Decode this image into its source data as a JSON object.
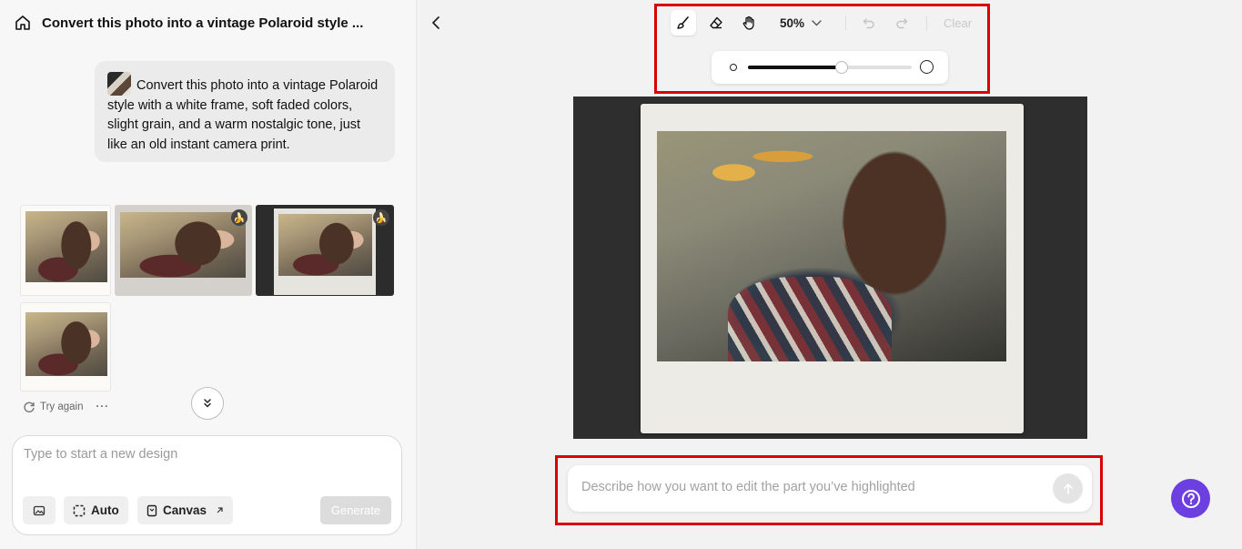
{
  "sidebar": {
    "title": "Convert this photo into a vintage Polaroid style ...",
    "prompt_bubble": "Convert this photo into a vintage Polaroid style with a white frame, soft faded colors, slight grain, and a warm nostalgic tone, just like an old instant camera print.",
    "actions": {
      "try_again": "Try again",
      "more": "···"
    },
    "composer": {
      "placeholder": "Type to start a new design",
      "auto_label": "Auto",
      "canvas_label": "Canvas",
      "generate_label": "Generate"
    }
  },
  "editor": {
    "zoom": "50%",
    "clear_label": "Clear",
    "brush_size_percent": 57,
    "prompt_placeholder": "Describe how you want to edit the part you’ve highlighted"
  },
  "colors": {
    "accent": "#6b3fe0",
    "highlight": "#d90000"
  }
}
